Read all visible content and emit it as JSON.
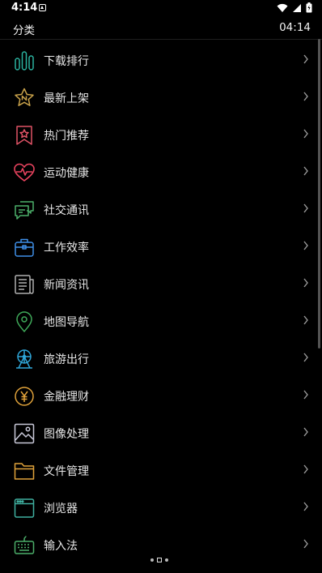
{
  "status_bar": {
    "time": "4:14"
  },
  "app_bar": {
    "title": "分类",
    "clock": "04:14"
  },
  "categories": [
    {
      "label": "下载排行",
      "icon": "ranking-bars-icon",
      "color": "#2bb3a0"
    },
    {
      "label": "最新上架",
      "icon": "star-new-icon",
      "color": "#c9a24a"
    },
    {
      "label": "热门推荐",
      "icon": "bookmark-star-icon",
      "color": "#e05366"
    },
    {
      "label": "运动健康",
      "icon": "heart-pulse-icon",
      "color": "#e8435e"
    },
    {
      "label": "社交通讯",
      "icon": "chat-bubbles-icon",
      "color": "#4caf6a"
    },
    {
      "label": "工作效率",
      "icon": "briefcase-icon",
      "color": "#3f8fe8"
    },
    {
      "label": "新闻资讯",
      "icon": "newspaper-icon",
      "color": "#b0b0b0"
    },
    {
      "label": "地图导航",
      "icon": "map-pin-icon",
      "color": "#3faa5a"
    },
    {
      "label": "旅游出行",
      "icon": "ferris-wheel-icon",
      "color": "#2fa6d8"
    },
    {
      "label": "金融理财",
      "icon": "yuan-coin-icon",
      "color": "#e0a23a"
    },
    {
      "label": "图像处理",
      "icon": "image-icon",
      "color": "#c9c9d9"
    },
    {
      "label": "文件管理",
      "icon": "folder-icon",
      "color": "#e0a23a"
    },
    {
      "label": "浏览器",
      "icon": "browser-window-icon",
      "color": "#3fb0a0"
    },
    {
      "label": "输入法",
      "icon": "keyboard-icon",
      "color": "#4caf6a"
    }
  ]
}
